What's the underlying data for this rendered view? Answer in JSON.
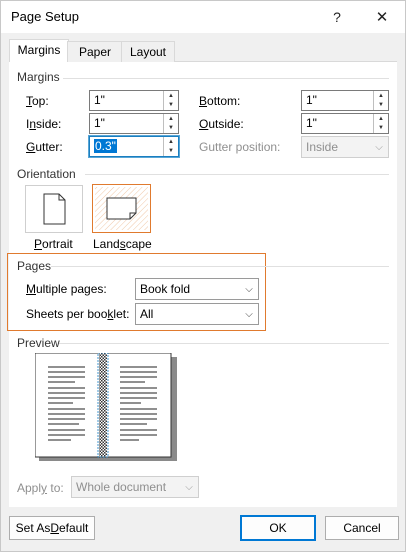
{
  "window": {
    "title": "Page Setup",
    "help_glyph": "?",
    "close_glyph": "✕"
  },
  "tabs": [
    {
      "label": "Margins",
      "active": true
    },
    {
      "label": "Paper",
      "active": false
    },
    {
      "label": "Layout",
      "active": false
    }
  ],
  "margins": {
    "group_label": "Margins",
    "top": {
      "label_prefix": "",
      "mnemonic": "T",
      "label_rest": "op:",
      "value": "1\""
    },
    "inside": {
      "label_prefix": "I",
      "mnemonic": "n",
      "label_rest": "side:",
      "value": "1\""
    },
    "gutter": {
      "label_prefix": "",
      "mnemonic": "G",
      "label_rest": "utter:",
      "value": "0.3\""
    },
    "bottom": {
      "label_prefix": "",
      "mnemonic": "B",
      "label_rest": "ottom:",
      "value": "1\""
    },
    "outside": {
      "label_prefix": "",
      "mnemonic": "O",
      "label_rest": "utside:",
      "value": "1\""
    },
    "gutter_position": {
      "label": "Gutter position:",
      "value": "Inside"
    }
  },
  "orientation": {
    "group_label": "Orientation",
    "portrait": {
      "label_prefix": "",
      "mnemonic": "P",
      "label_rest": "ortrait"
    },
    "landscape": {
      "label_prefix": "Land",
      "mnemonic": "s",
      "label_rest": "cape",
      "selected": true
    }
  },
  "pages": {
    "group_label": "Pages",
    "multiple_pages": {
      "label_prefix": "",
      "mnemonic": "M",
      "label_rest": "ultiple pages:",
      "value": "Book fold"
    },
    "sheets_per_booklet": {
      "label_prefix": "Sheets per boo",
      "mnemonic": "k",
      "label_rest": "let:",
      "value": "All"
    }
  },
  "preview": {
    "group_label": "Preview"
  },
  "apply_to": {
    "label_prefix": "Appl",
    "mnemonic": "y",
    "label_rest": " to:",
    "value": "Whole document"
  },
  "buttons": {
    "set_default": {
      "label_prefix": "Set As ",
      "mnemonic": "D",
      "label_rest": "efault"
    },
    "ok": "OK",
    "cancel": "Cancel"
  },
  "colors": {
    "accent_orange": "#e07a2e",
    "focus_blue": "#1a7ec0",
    "default_blue": "#0078d4"
  }
}
